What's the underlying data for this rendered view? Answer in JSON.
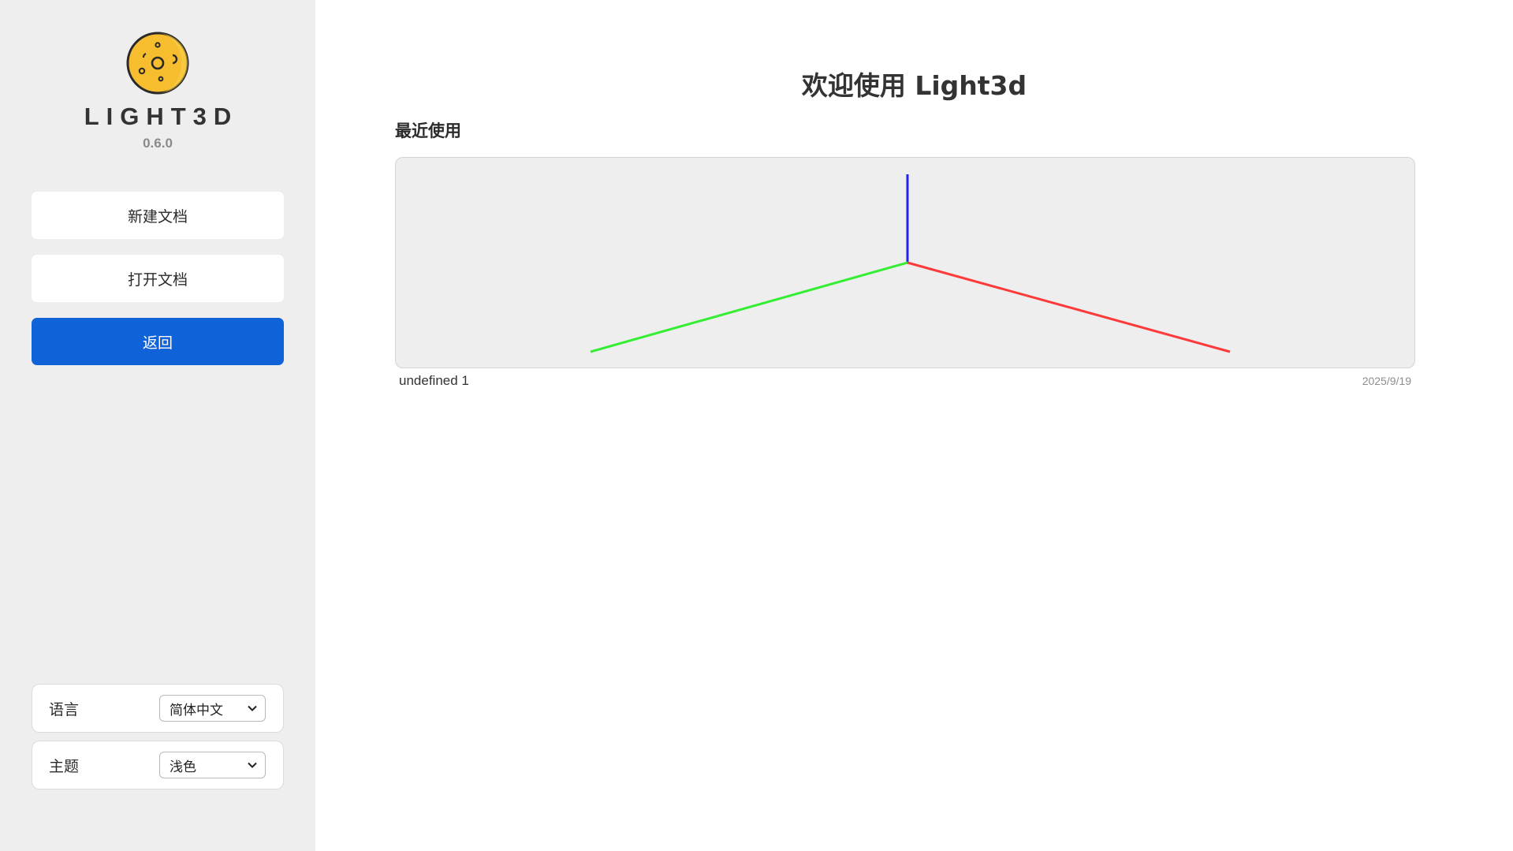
{
  "sidebar": {
    "app_name": "LIGHT3D",
    "version": "0.6.0",
    "logo_icon": "moon-logo-icon",
    "buttons": {
      "new_doc": "新建文档",
      "open_doc": "打开文档",
      "back": "返回"
    },
    "settings": {
      "language": {
        "label": "语言",
        "value": "简体中文"
      },
      "theme": {
        "label": "主题",
        "value": "浅色"
      }
    }
  },
  "main": {
    "welcome": "欢迎使用 Light3d",
    "recent_title": "最近使用",
    "recent": [
      {
        "name": "undefined 1",
        "date": "2025/9/19"
      }
    ]
  },
  "colors": {
    "accent": "#1062d9",
    "axis_x": "#ff3a3a",
    "axis_y": "#33ee33",
    "axis_z": "#2222ee",
    "logo_fill": "#f6bd2e",
    "sidebar_bg": "#eeeeee"
  }
}
